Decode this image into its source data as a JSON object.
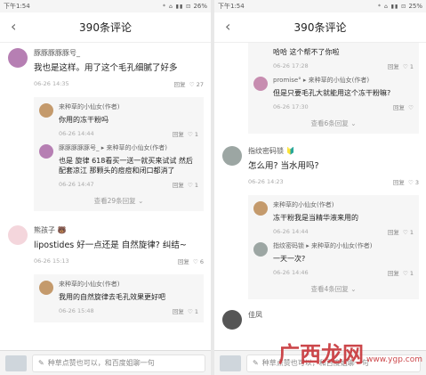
{
  "left": {
    "status": {
      "time": "下午1:54",
      "icons": "* ⌂ ▮▮ ⊡",
      "battery": "26%"
    },
    "header": {
      "title": "390条评论"
    },
    "comments": [
      {
        "username": "豚豚豚豚豚号_",
        "text": "我也是这样。用了这个毛孔细腻了好多",
        "date": "06-26 14:35",
        "reply_label": "回复",
        "likes": "27",
        "replies": [
          {
            "username": "来种草的小仙女(作者)",
            "text": "你用的冻干粉吗",
            "date": "06-26 14:44",
            "reply_label": "回复",
            "likes": "1"
          },
          {
            "username": "豚豚豚豚豚号_ ▸ 来种草的小仙女(作者)",
            "text": "也是 旋律 618看买一送一就买来试试 然后配套凉江 那颗头的痘痘和闭口都消了",
            "date": "06-26 14:47",
            "reply_label": "回复",
            "likes": "1"
          }
        ],
        "more_label": "查看29条回复"
      },
      {
        "username": "熊孩子",
        "text": "lipostides 好一点还是 自然旋律? 纠结~",
        "date": "06-26 15:13",
        "reply_label": "回复",
        "likes": "6",
        "replies": [
          {
            "username": "来种草的小仙女(作者)",
            "text": "我用的自然旋律去毛孔效果更好吧",
            "date": "06-26 15:48",
            "reply_label": "回复",
            "likes": "1"
          }
        ],
        "more_label": ""
      }
    ],
    "input_placeholder": "种草点赞也可以，和百度姐聊一句"
  },
  "right": {
    "status": {
      "time": "下午1:54",
      "icons": "* ⌂ ▮▮ ⊡",
      "battery": "25%"
    },
    "header": {
      "title": "390条评论"
    },
    "top_replies": [
      {
        "username": "",
        "text": "哈哈 这个帮不了你啦",
        "date": "06-26 17:28",
        "reply_label": "回复",
        "likes": "1"
      },
      {
        "username": "promise° ▸ 来种草的小仙女(作者)",
        "text": "但是只要毛孔大就能用这个冻干粉嘛?",
        "date": "06-26 17:30",
        "reply_label": "回复",
        "likes": ""
      }
    ],
    "top_more_label": "查看6条回复",
    "comments": [
      {
        "username": "指纹密码锁",
        "text": "怎么用? 当水用吗?",
        "date": "06-26 14:23",
        "reply_label": "回复",
        "likes": "3",
        "replies": [
          {
            "username": "来种草的小仙女(作者)",
            "text": "冻干粉我是当精华液来用的",
            "date": "06-26 14:44",
            "reply_label": "回复",
            "likes": "1"
          },
          {
            "username": "指纹密码锁 ▸ 来种草的小仙女(作者)",
            "text": "一天一次?",
            "date": "06-26 14:46",
            "reply_label": "回复",
            "likes": "1"
          }
        ],
        "more_label": "查看4条回复"
      },
      {
        "username": "佳凤",
        "text": "",
        "date": "",
        "reply_label": "",
        "likes": "",
        "replies": [],
        "more_label": ""
      }
    ],
    "input_placeholder": "种草点赞也可以，和百度姐聊一句"
  },
  "watermark": {
    "big": "广西龙网",
    "small": "www.ygp.com"
  }
}
